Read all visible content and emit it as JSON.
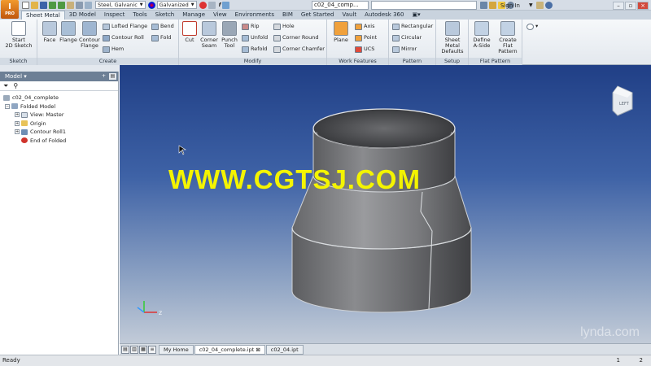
{
  "app": {
    "logo_text": "I",
    "logo_sub": "PRO",
    "document_title": "c02_04_comp...",
    "sign_in": "Sign In"
  },
  "quick_access": {
    "material": "Steel, Galvanic",
    "appearance": "Galvanized",
    "fx": "f"
  },
  "tabs": [
    "Sheet Metal",
    "3D Model",
    "Inspect",
    "Tools",
    "Sketch",
    "Manage",
    "View",
    "Environments",
    "BIM",
    "Get Started",
    "Vault",
    "Autodesk 360"
  ],
  "ribbon": {
    "sketch": {
      "label": "Sketch",
      "start": "Start",
      "sketch2d": "2D Sketch"
    },
    "create": {
      "label": "Create",
      "face": "Face",
      "flange": "Flange",
      "contour": "Contour",
      "contour_flange": "Flange",
      "lofted_flange": "Lofted Flange",
      "contour_roll": "Contour Roll",
      "hem": "Hem",
      "bend": "Bend",
      "fold": "Fold"
    },
    "modify": {
      "label": "Modify",
      "cut": "Cut",
      "corner": "Corner",
      "seam": "Seam",
      "punch": "Punch",
      "tool": "Tool",
      "rip": "Rip",
      "unfold": "Unfold",
      "refold": "Refold",
      "hole": "Hole",
      "corner_round": "Corner Round",
      "corner_chamfer": "Corner Chamfer"
    },
    "work_features": {
      "label": "Work Features",
      "plane": "Plane",
      "axis": "Axis",
      "point": "Point",
      "ucs": "UCS"
    },
    "pattern": {
      "label": "Pattern",
      "rectangular": "Rectangular",
      "circular": "Circular",
      "mirror": "Mirror"
    },
    "setup": {
      "label": "Setup",
      "sheet_metal": "Sheet Metal",
      "defaults": "Defaults"
    },
    "flat_pattern": {
      "label": "Flat Pattern",
      "define": "Define",
      "a_side": "A-Side",
      "create": "Create",
      "flat_pattern": "Flat Pattern"
    }
  },
  "browser": {
    "title": "Model",
    "tree": [
      {
        "label": "c02_04_complete",
        "level": 0
      },
      {
        "label": "Folded Model",
        "level": 0
      },
      {
        "label": "View: Master",
        "level": 1
      },
      {
        "label": "Origin",
        "level": 1
      },
      {
        "label": "Contour Roll1",
        "level": 1
      },
      {
        "label": "End of Folded",
        "level": 1
      }
    ]
  },
  "viewport": {
    "watermark": "WWW.CGTSJ.COM",
    "brand": "lynda.com",
    "viewcube_label": "LEFT"
  },
  "doc_tabs": [
    "My Home",
    "c02_04_complete.ipt",
    "c02_04.ipt"
  ],
  "status": {
    "text": "Ready",
    "n1": "1",
    "n2": "2"
  },
  "colors": {
    "accent": "#f29a2e",
    "viewport_top": "#203f86",
    "watermark": "#f4f400"
  }
}
